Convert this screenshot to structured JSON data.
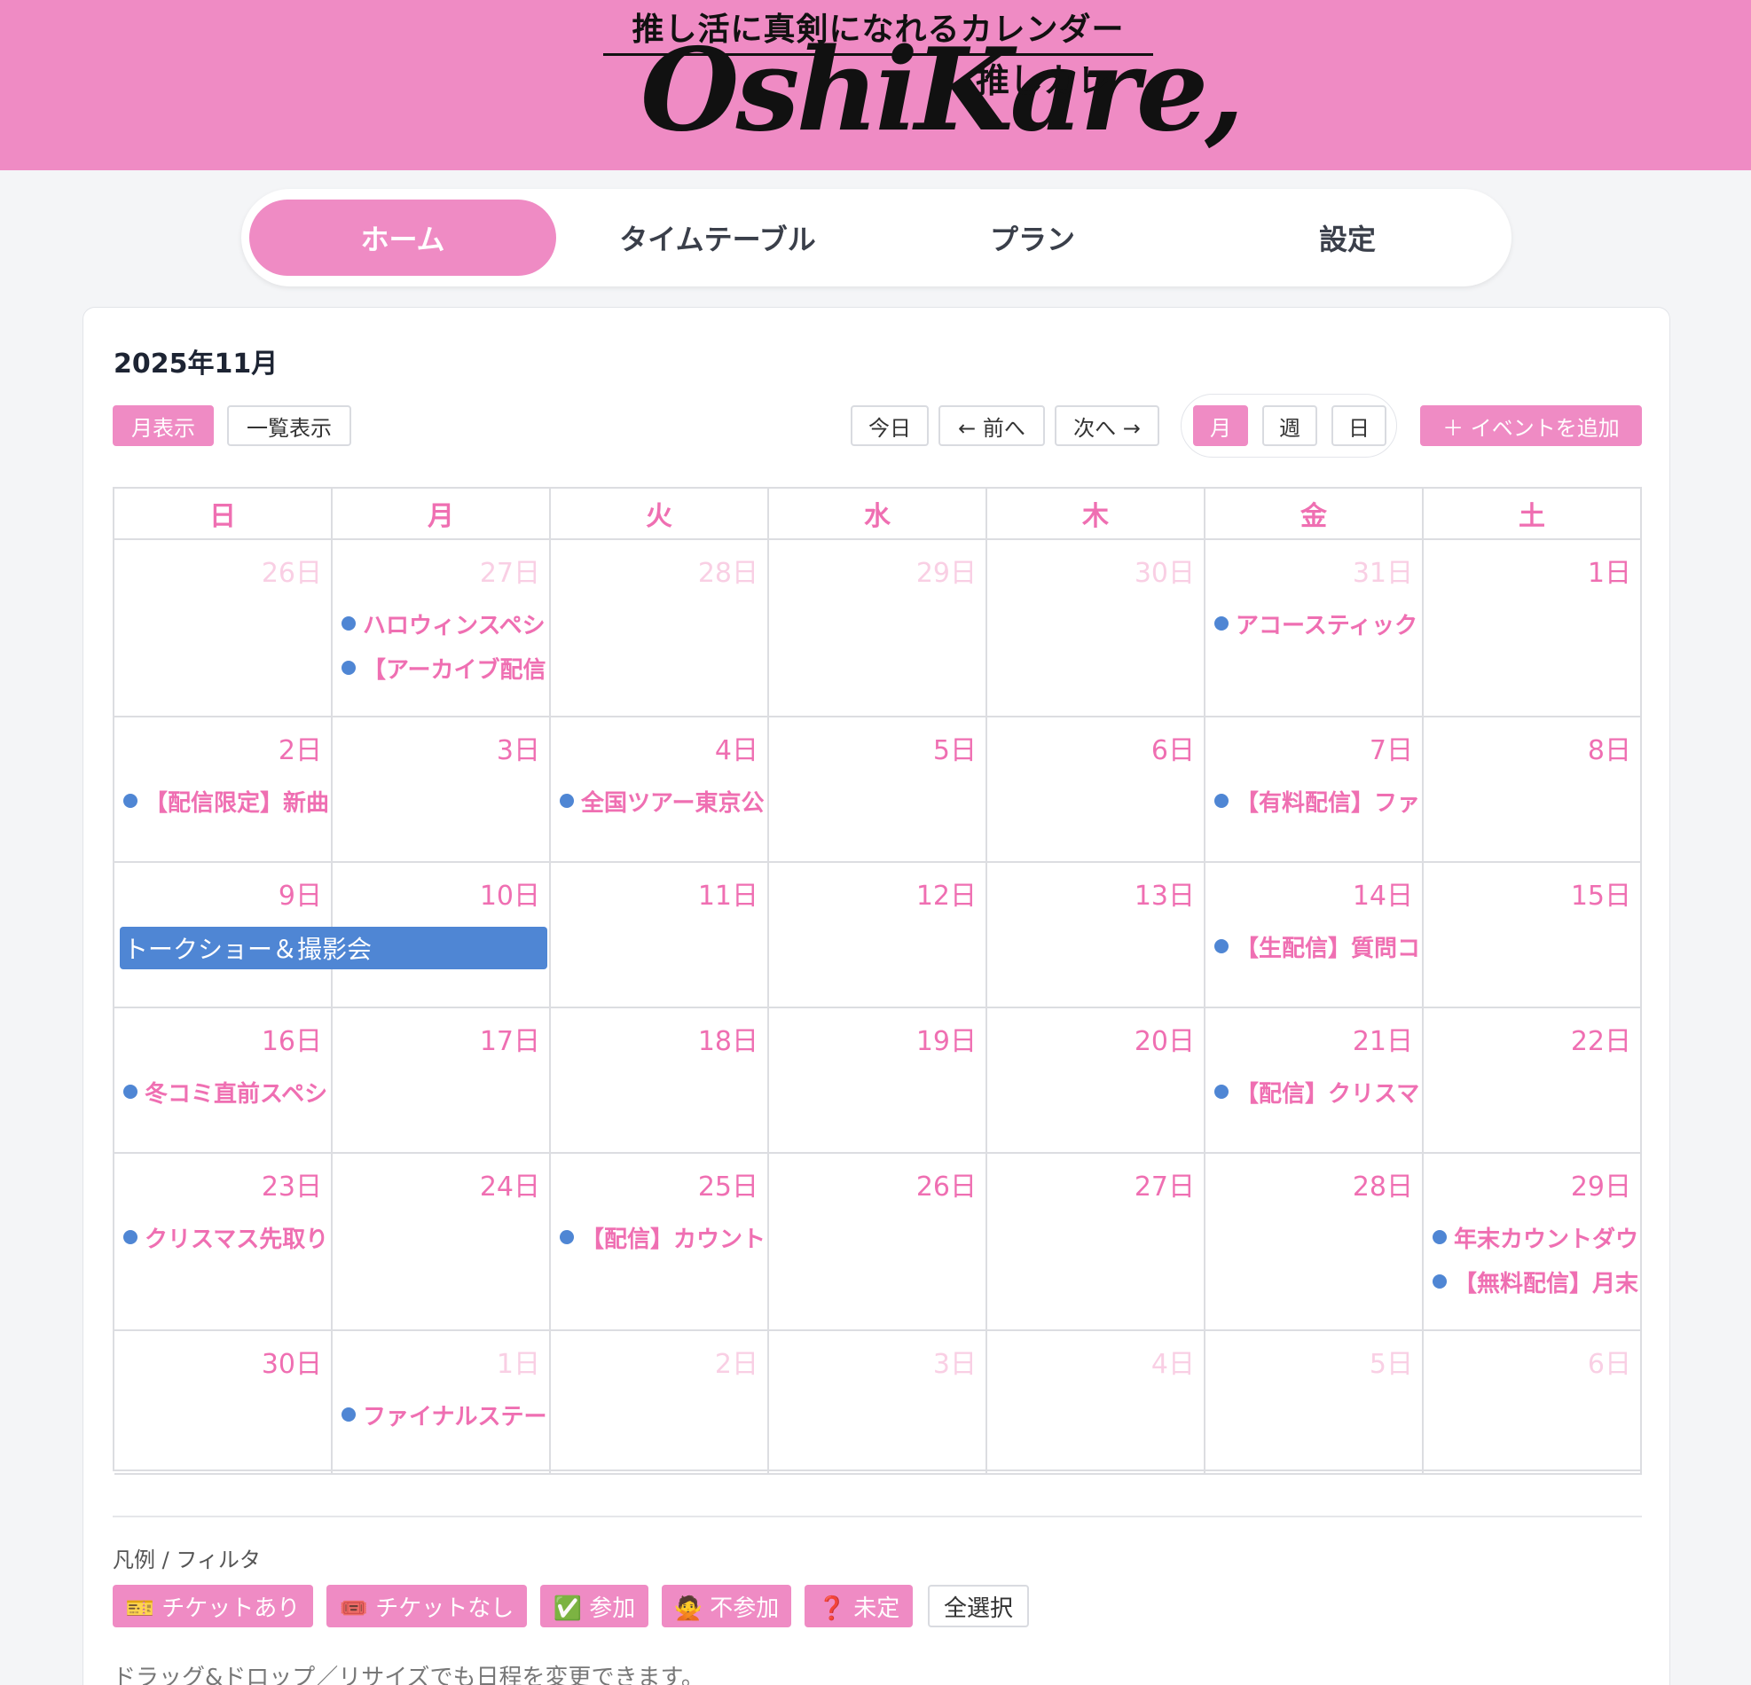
{
  "header": {
    "tagline": "推し活に真剣になれるカレンダー",
    "logo_script": "OshiKare,",
    "logo_kana": "推しカレ",
    "bg_color": "#ef8bc4"
  },
  "nav": {
    "tabs": [
      {
        "label": "ホーム",
        "active": true
      },
      {
        "label": "タイムテーブル",
        "active": false
      },
      {
        "label": "プラン",
        "active": false
      },
      {
        "label": "設定",
        "active": false
      }
    ]
  },
  "calendar": {
    "title": "2025年11月",
    "toolbar": {
      "month_view": "月表示",
      "list_view": "一覧表示",
      "today": "今日",
      "prev": "← 前へ",
      "next": "次へ →",
      "view_month": "月",
      "view_week": "週",
      "view_day": "日",
      "add_event": "＋ イベントを追加"
    },
    "weekdays": [
      "日",
      "月",
      "火",
      "水",
      "木",
      "金",
      "土"
    ],
    "weeks": [
      [
        {
          "day": "26日",
          "muted": true,
          "events": []
        },
        {
          "day": "27日",
          "muted": true,
          "events": [
            "ハロウィンスペシ",
            "【アーカイブ配信"
          ]
        },
        {
          "day": "28日",
          "muted": true,
          "events": []
        },
        {
          "day": "29日",
          "muted": true,
          "events": []
        },
        {
          "day": "30日",
          "muted": true,
          "events": []
        },
        {
          "day": "31日",
          "muted": true,
          "events": [
            "アコースティック"
          ]
        },
        {
          "day": "1日",
          "muted": false,
          "events": []
        }
      ],
      [
        {
          "day": "2日",
          "muted": false,
          "events": [
            "【配信限定】新曲"
          ]
        },
        {
          "day": "3日",
          "muted": false,
          "events": []
        },
        {
          "day": "4日",
          "muted": false,
          "events": [
            "全国ツアー東京公"
          ]
        },
        {
          "day": "5日",
          "muted": false,
          "events": []
        },
        {
          "day": "6日",
          "muted": false,
          "events": []
        },
        {
          "day": "7日",
          "muted": false,
          "events": [
            "【有料配信】ファ"
          ]
        },
        {
          "day": "8日",
          "muted": false,
          "events": []
        }
      ],
      [
        {
          "day": "9日",
          "muted": false,
          "events": []
        },
        {
          "day": "10日",
          "muted": false,
          "events": []
        },
        {
          "day": "11日",
          "muted": false,
          "events": []
        },
        {
          "day": "12日",
          "muted": false,
          "events": []
        },
        {
          "day": "13日",
          "muted": false,
          "events": []
        },
        {
          "day": "14日",
          "muted": false,
          "events": [
            "【生配信】質問コ"
          ]
        },
        {
          "day": "15日",
          "muted": false,
          "events": []
        }
      ],
      [
        {
          "day": "16日",
          "muted": false,
          "events": [
            "冬コミ直前スペシ"
          ]
        },
        {
          "day": "17日",
          "muted": false,
          "events": []
        },
        {
          "day": "18日",
          "muted": false,
          "events": []
        },
        {
          "day": "19日",
          "muted": false,
          "events": []
        },
        {
          "day": "20日",
          "muted": false,
          "events": []
        },
        {
          "day": "21日",
          "muted": false,
          "events": [
            "【配信】クリスマ"
          ]
        },
        {
          "day": "22日",
          "muted": false,
          "events": []
        }
      ],
      [
        {
          "day": "23日",
          "muted": false,
          "events": [
            "クリスマス先取り"
          ]
        },
        {
          "day": "24日",
          "muted": false,
          "events": []
        },
        {
          "day": "25日",
          "muted": false,
          "events": [
            "【配信】カウント"
          ]
        },
        {
          "day": "26日",
          "muted": false,
          "events": []
        },
        {
          "day": "27日",
          "muted": false,
          "events": []
        },
        {
          "day": "28日",
          "muted": false,
          "events": []
        },
        {
          "day": "29日",
          "muted": false,
          "events": [
            "年末カウントダウ",
            "【無料配信】月末"
          ]
        }
      ],
      [
        {
          "day": "30日",
          "muted": false,
          "events": []
        },
        {
          "day": "1日",
          "muted": true,
          "events": [
            "ファイナルステー"
          ]
        },
        {
          "day": "2日",
          "muted": true,
          "events": []
        },
        {
          "day": "3日",
          "muted": true,
          "events": []
        },
        {
          "day": "4日",
          "muted": true,
          "events": []
        },
        {
          "day": "5日",
          "muted": true,
          "events": []
        },
        {
          "day": "6日",
          "muted": true,
          "events": []
        }
      ]
    ],
    "spanning_event": "トークショー＆撮影会",
    "event_dot_color": "#4f86d4",
    "accent_color": "#ef6fb2"
  },
  "legend": {
    "label": "凡例 / フィルタ",
    "chips": [
      "🎫 チケットあり",
      "🎟️ チケットなし",
      "✅ 参加",
      "🙅 不参加",
      "❓ 未定"
    ],
    "select_all": "全選択"
  },
  "hint": "ドラッグ&ドロップ／リサイズでも日程を変更できます。"
}
